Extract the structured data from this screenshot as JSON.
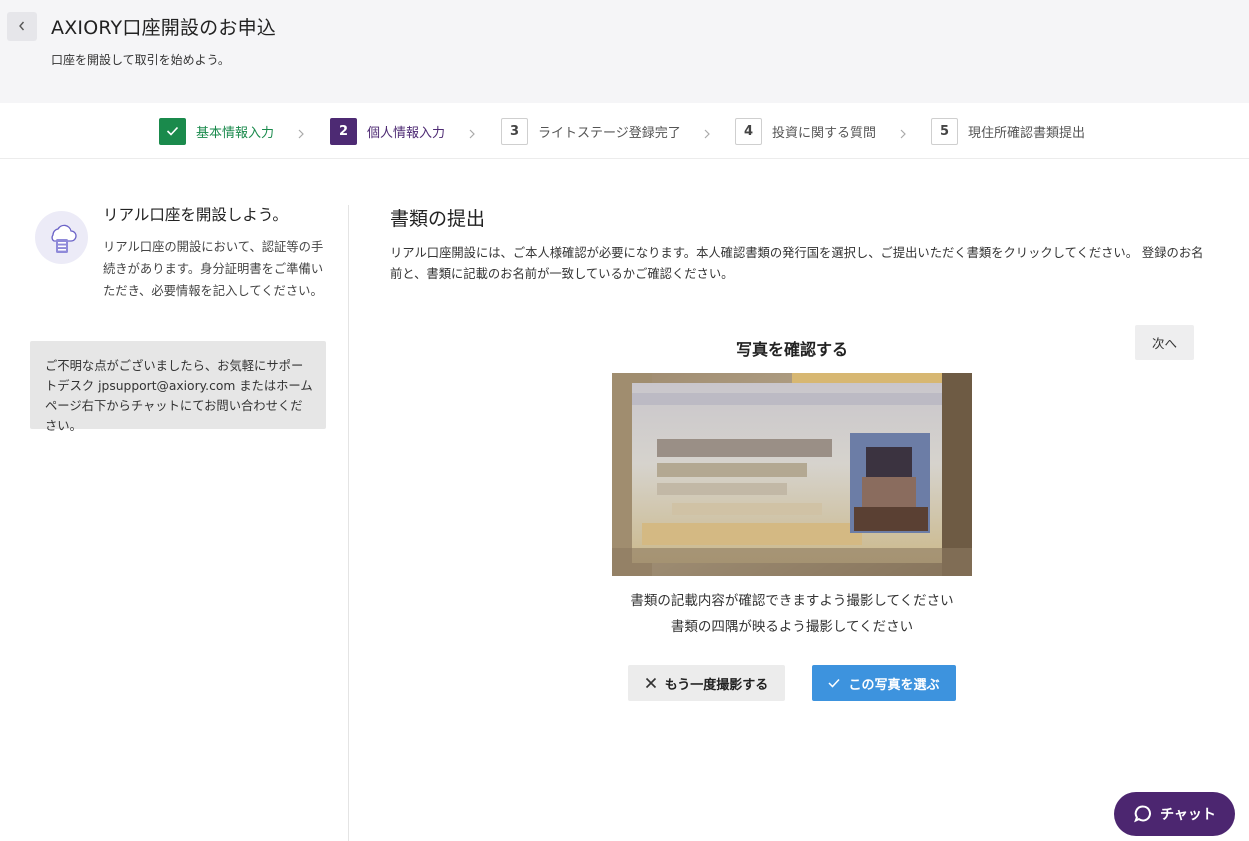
{
  "header": {
    "title": "AXIORY口座開設のお申込",
    "subtitle": "口座を開設して取引を始めよう。",
    "back_icon": "chevron-left-icon"
  },
  "stepper": {
    "steps": [
      {
        "number": "",
        "label": "基本情報入力",
        "state": "done",
        "icon": "check-icon"
      },
      {
        "number": "2",
        "label": "個人情報入力",
        "state": "active"
      },
      {
        "number": "3",
        "label": "ライトステージ登録完了",
        "state": "todo"
      },
      {
        "number": "4",
        "label": "投資に関する質問",
        "state": "todo"
      },
      {
        "number": "5",
        "label": "現住所確認書類提出",
        "state": "todo"
      }
    ]
  },
  "sidebar": {
    "title": "リアル口座を開設しよう。",
    "description": "リアル口座の開設において、認証等の手続きがあります。身分証明書をご準備いただき、必要情報を記入してください。",
    "support_text": "ご不明な点がございましたら、お気軽にサポートデスク jpsupport@axiory.com またはホームページ右下からチャットにてお問い合わせください。"
  },
  "main": {
    "title": "書類の提出",
    "description": "リアル口座開設には、ご本人様確認が必要になります。本人確認書類の発行国を選択し、ご提出いただく書類をクリックしてください。 登録のお名前と、書類に記載のお名前が一致しているかご確認ください。",
    "next_label": "次へ",
    "photo_title": "写真を確認する",
    "hint_1": "書類の記載内容が確認できますよう撮影してください",
    "hint_2": "書類の四隅が映るよう撮影してください",
    "retake_label": "もう一度撮影する",
    "select_label": "この写真を選ぶ"
  },
  "chat": {
    "label": "チャット"
  },
  "colors": {
    "done": "#1a8a4c",
    "active": "#4d2a73",
    "primary_button": "#3d93de",
    "chat": "#4c2670"
  }
}
